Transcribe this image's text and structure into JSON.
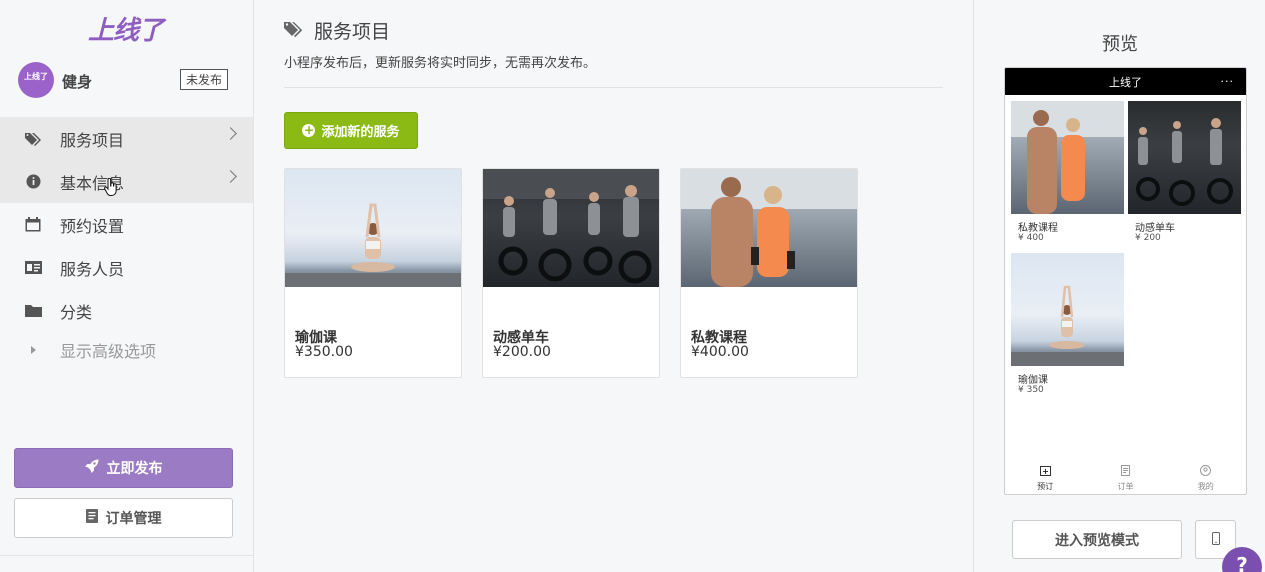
{
  "brand": {
    "logo_text": "上线了",
    "accent": "#9b7bc3",
    "add_green": "#8bba14"
  },
  "shop": {
    "avatar_text": "上线了",
    "name": "健身",
    "status_badge": "未发布"
  },
  "sidebar": {
    "items": [
      {
        "label": "服务项目",
        "icon": "tags-icon",
        "active": true
      },
      {
        "label": "基本信息",
        "icon": "info-circle-icon",
        "active": true
      },
      {
        "label": "预约设置",
        "icon": "calendar-icon",
        "active": false
      },
      {
        "label": "服务人员",
        "icon": "id-card-icon",
        "active": false
      },
      {
        "label": "分类",
        "icon": "folder-icon",
        "active": false
      }
    ],
    "advanced_label": "显示高级选项",
    "publish_label": "立即发布",
    "orders_label": "订单管理"
  },
  "main": {
    "title": "服务项目",
    "description": "小程序发布后，更新服务将实时同步，无需再次发布。",
    "add_button_label": "添加新的服务",
    "services": [
      {
        "name": "瑜伽课",
        "price": "¥350.00",
        "image": "yoga"
      },
      {
        "name": "动感单车",
        "price": "¥200.00",
        "image": "spinning"
      },
      {
        "name": "私教课程",
        "price": "¥400.00",
        "image": "personal-training"
      }
    ]
  },
  "preview": {
    "title": "预览",
    "phone_title": "上线了",
    "phone_menu": "···",
    "items": [
      {
        "name": "私教课程",
        "price": "¥ 400",
        "image": "personal-training"
      },
      {
        "name": "动感单车",
        "price": "¥ 200",
        "image": "spinning"
      },
      {
        "name": "瑜伽课",
        "price": "¥ 350",
        "image": "yoga"
      }
    ],
    "tabs": [
      {
        "label": "预订",
        "icon": "calendar-plus-icon",
        "active": true
      },
      {
        "label": "订单",
        "icon": "file-text-icon",
        "active": false
      },
      {
        "label": "我的",
        "icon": "user-circle-icon",
        "active": false
      }
    ],
    "enter_preview_label": "进入预览模式",
    "help_label": "?"
  }
}
